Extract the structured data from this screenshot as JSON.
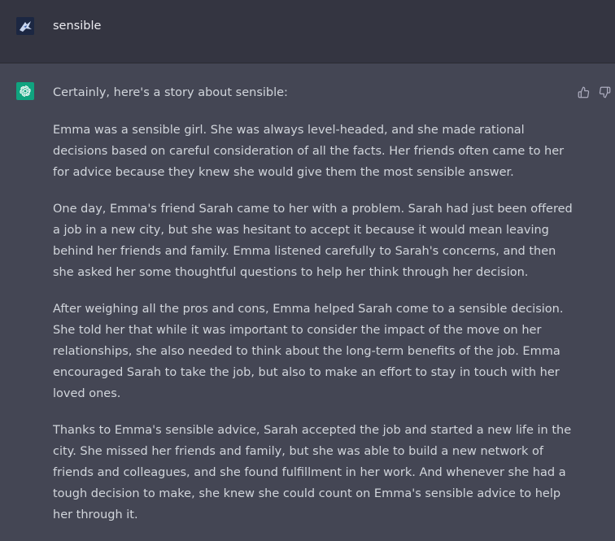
{
  "user_message": {
    "text": "sensible",
    "avatar_icon": "user-avatar-icon"
  },
  "assistant_message": {
    "avatar_icon": "openai-logo-icon",
    "intro": "Certainly, here's a story about sensible:",
    "paragraphs": [
      "Emma was a sensible girl. She was always level-headed, and she made rational decisions based on careful consideration of all the facts. Her friends often came to her for advice because they knew she would give them the most sensible answer.",
      "One day, Emma's friend Sarah came to her with a problem. Sarah had just been offered a job in a new city, but she was hesitant to accept it because it would mean leaving behind her friends and family. Emma listened carefully to Sarah's concerns, and then she asked her some thoughtful questions to help her think through her decision.",
      "After weighing all the pros and cons, Emma helped Sarah come to a sensible decision. She told her that while it was important to consider the impact of the move on her relationships, she also needed to think about the long-term benefits of the job. Emma encouraged Sarah to take the job, but also to make an effort to stay in touch with her loved ones.",
      "Thanks to Emma's sensible advice, Sarah accepted the job and started a new life in the city. She missed her friends and family, but she was able to build a new network of friends and colleagues, and she found fulfillment in her work. And whenever she had a tough decision to make, she knew she could count on Emma's sensible advice to help her through it."
    ],
    "feedback": {
      "thumbs_up_icon": "thumbs-up-icon",
      "thumbs_down_icon": "thumbs-down-icon"
    }
  },
  "colors": {
    "user_bg": "#343541",
    "assistant_bg": "#444654",
    "text": "#d1d5db",
    "accent": "#10a37f"
  }
}
